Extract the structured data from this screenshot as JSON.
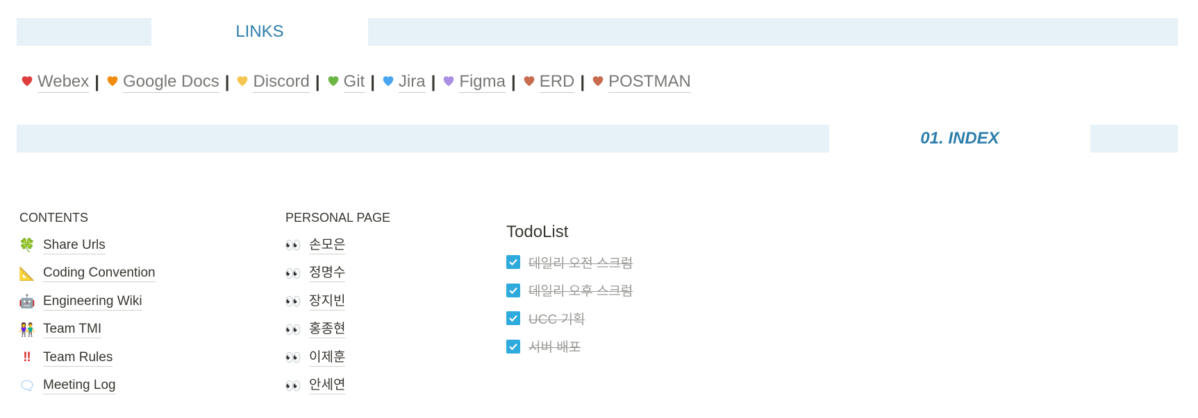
{
  "links_header": "LINKS",
  "links": [
    {
      "label": "Webex",
      "color": "#e03e3e"
    },
    {
      "label": "Google Docs",
      "color": "#f28c0f"
    },
    {
      "label": "Discord",
      "color": "#f5c64f"
    },
    {
      "label": "Git",
      "color": "#6cb545"
    },
    {
      "label": "Jira",
      "color": "#4aa5f0"
    },
    {
      "label": "Figma",
      "color": "#a98fe3"
    },
    {
      "label": "ERD",
      "color": "#c86b4f"
    },
    {
      "label": "POSTMAN",
      "color": "#c86b4f"
    }
  ],
  "separator": "|",
  "index_header": "01. INDEX",
  "contents": {
    "title": "CONTENTS",
    "items": [
      {
        "label": "Share Urls",
        "icon": "four-leaf-clover-icon",
        "glyph": "🍀"
      },
      {
        "label": "Coding Convention",
        "icon": "triangular-ruler-icon",
        "glyph": "📐"
      },
      {
        "label": "Engineering Wiki",
        "icon": "robot-icon",
        "glyph": "🤖"
      },
      {
        "label": "Team TMI",
        "icon": "people-icon",
        "glyph": "👫"
      },
      {
        "label": "Team Rules",
        "icon": "double-exclamation-icon",
        "glyph": "‼"
      },
      {
        "label": "Meeting Log",
        "icon": "speech-bubble-icon",
        "glyph": "🗨"
      }
    ]
  },
  "personal": {
    "title": "PERSONAL PAGE",
    "items": [
      {
        "label": "손모은",
        "icon": "eyes-icon",
        "glyph": "👀"
      },
      {
        "label": "정명수",
        "icon": "eyes-icon",
        "glyph": "👀"
      },
      {
        "label": "장지빈",
        "icon": "eyes-icon",
        "glyph": "👀"
      },
      {
        "label": "홍종현",
        "icon": "eyes-icon",
        "glyph": "👀"
      },
      {
        "label": "이제훈",
        "icon": "eyes-icon",
        "glyph": "👀"
      },
      {
        "label": "안세연",
        "icon": "eyes-icon",
        "glyph": "👀"
      }
    ]
  },
  "todo": {
    "title": "TodoList",
    "items": [
      {
        "label": "데일리 오전 스크럼",
        "checked": true
      },
      {
        "label": "데일리 오후 스크럼",
        "checked": true
      },
      {
        "label": "UCC 기획",
        "checked": true
      },
      {
        "label": "서버 배포",
        "checked": true
      }
    ]
  }
}
